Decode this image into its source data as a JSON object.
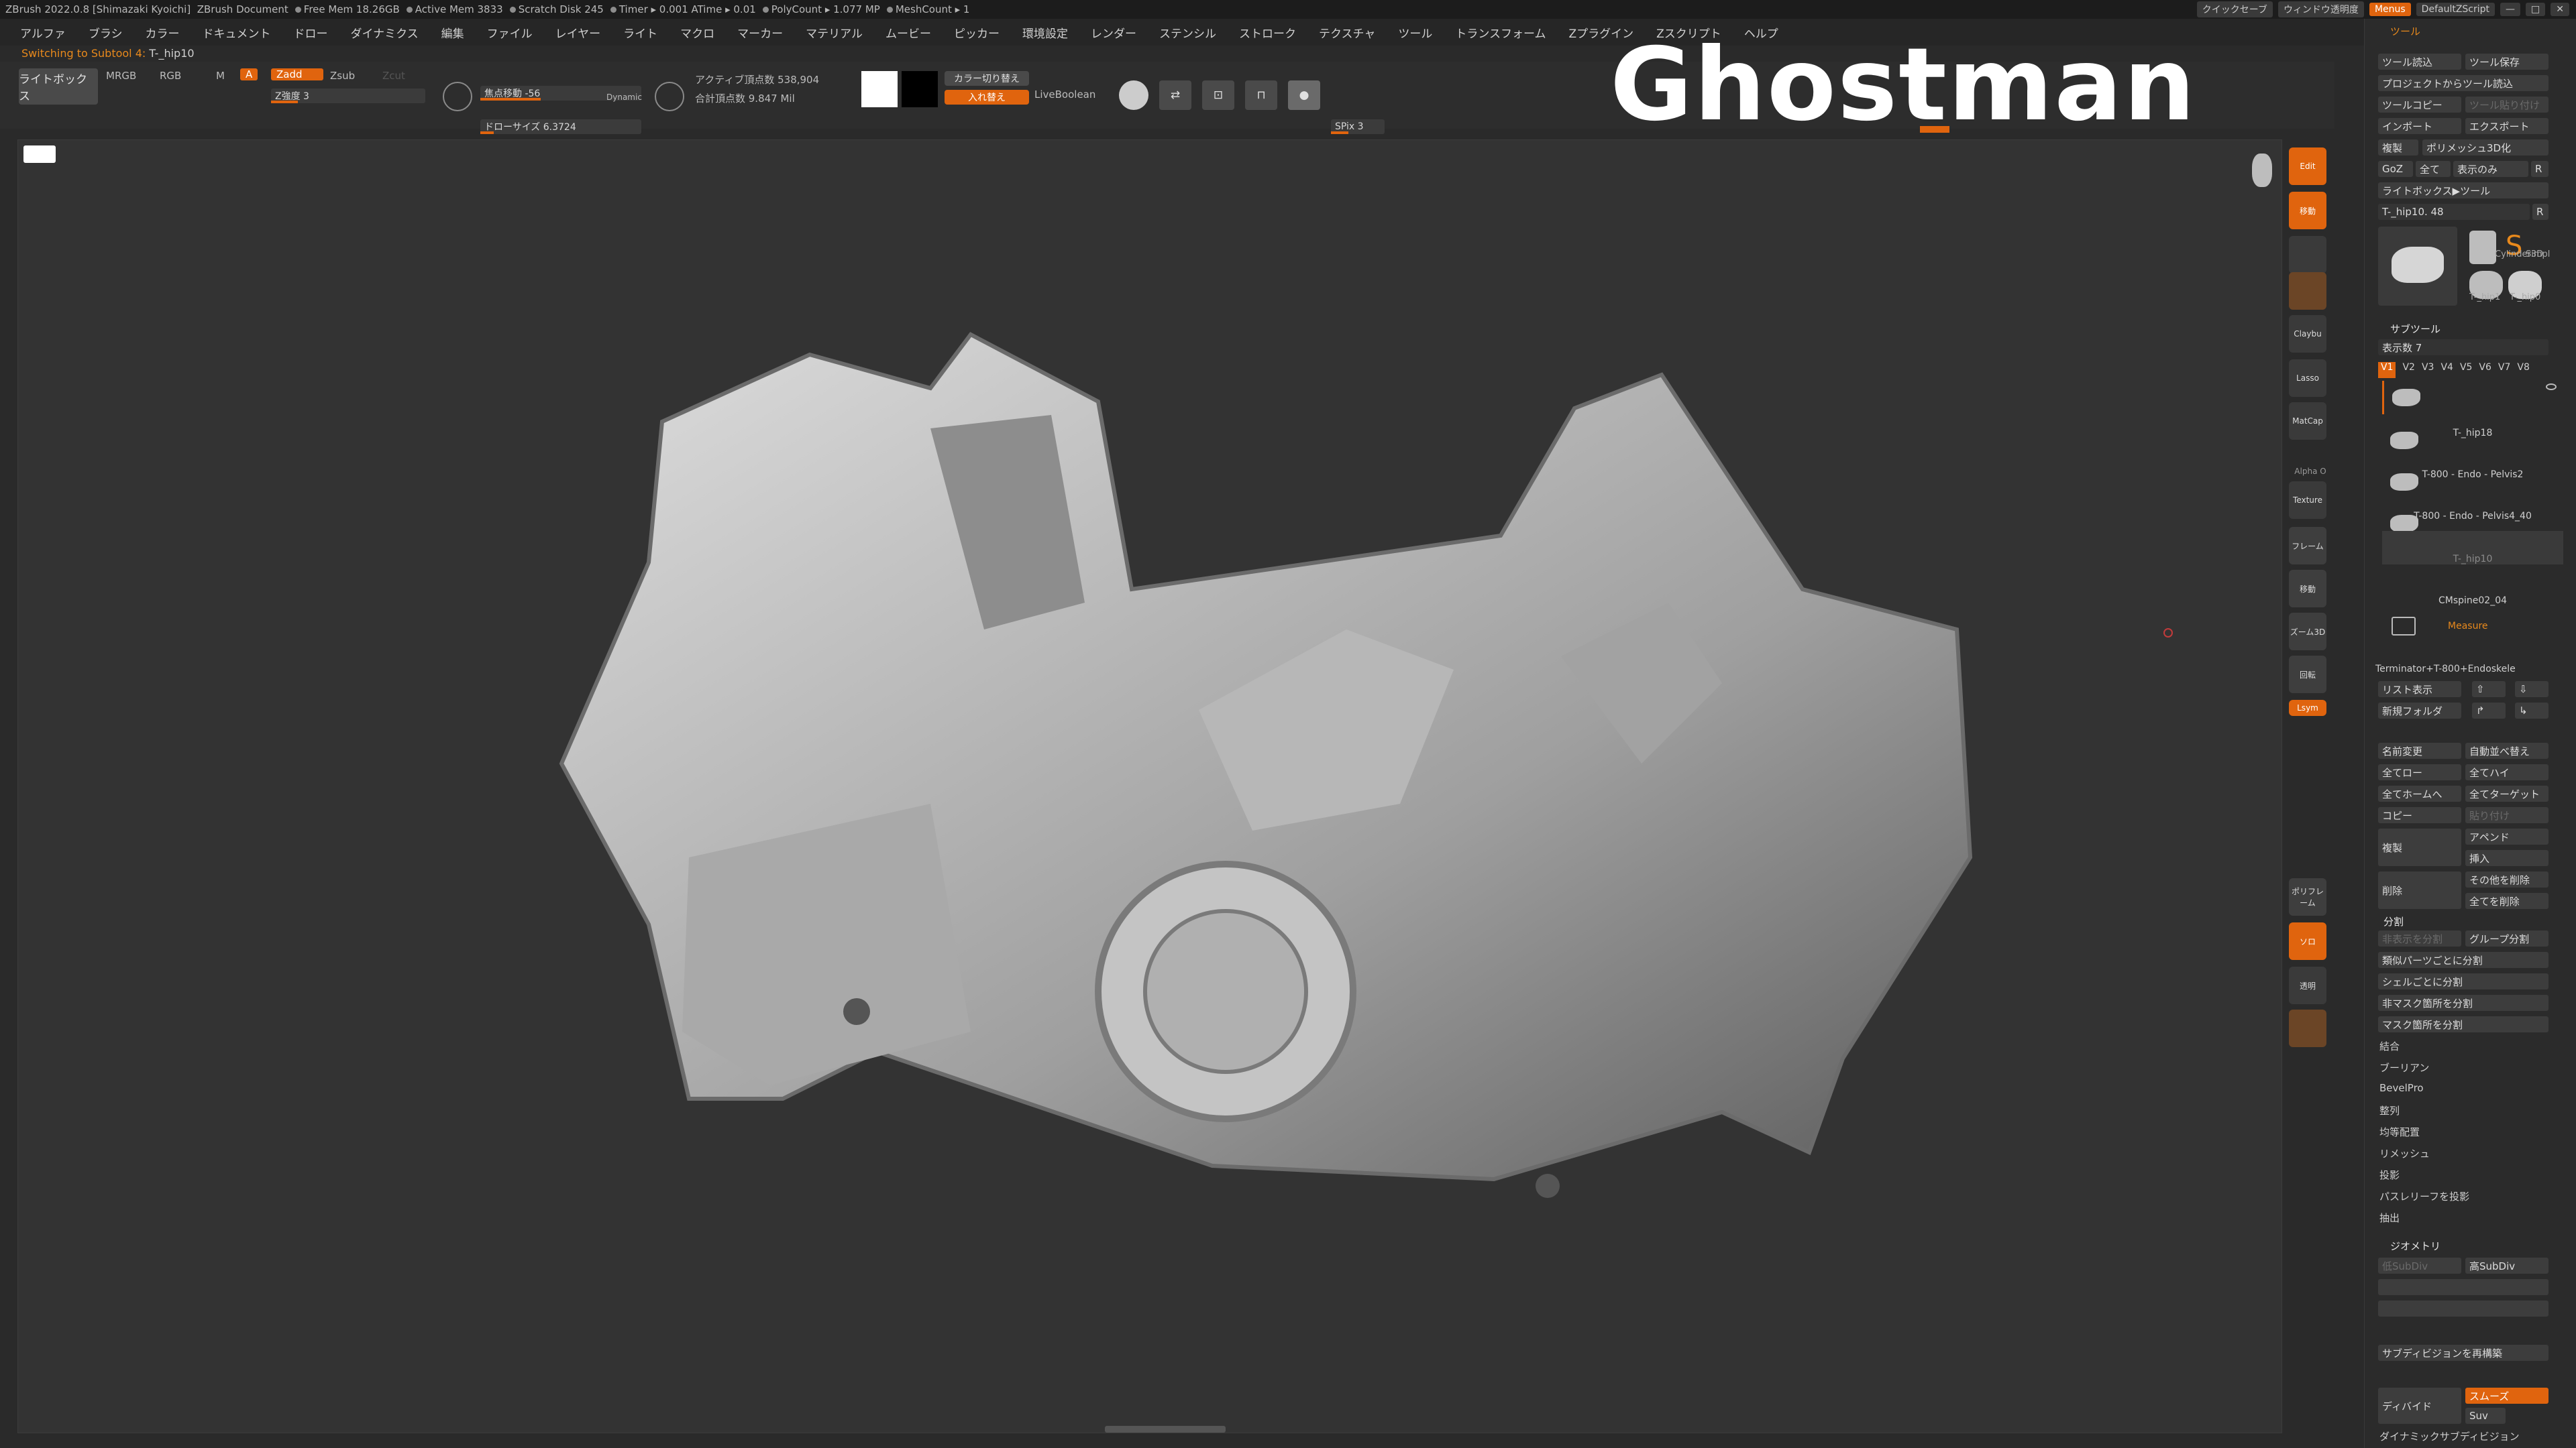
{
  "titlebar": {
    "app": "ZBrush 2022.0.8 [Shimazaki Kyoichi]",
    "doc": "ZBrush Document",
    "free_mem": "Free Mem 18.26GB",
    "active_mem": "Active Mem 3833",
    "scratch": "Scratch Disk 245",
    "timer": "Timer ▸ 0.001 ATime ▸ 0.01",
    "polycount": "PolyCount ▸ 1.077 MP",
    "meshcount": "MeshCount ▸ 1",
    "quicksave": "クイックセーブ",
    "window_transparency": "ウィンドウ透明度",
    "menus": "Menus",
    "script": "DefaultZScript"
  },
  "menubar": [
    "アルファ",
    "ブラシ",
    "カラー",
    "ドキュメント",
    "ドロー",
    "ダイナミクス",
    "編集",
    "ファイル",
    "レイヤー",
    "ライト",
    "マクロ",
    "マーカー",
    "マテリアル",
    "ムービー",
    "ピッカー",
    "環境設定",
    "レンダー",
    "ステンシル",
    "ストローク",
    "テクスチャ",
    "ツール",
    "トランスフォーム",
    "Zプラグイン",
    "Zスクリプト",
    "ヘルプ"
  ],
  "status": {
    "prefix": "Switching to Subtool 4:",
    "name": "T-_hip10"
  },
  "toolbar": {
    "lightbox": "ライトボックス",
    "mrgb": "MRGB",
    "rgb": "RGB",
    "m": "M",
    "a": "A",
    "zadd": "Zadd",
    "zsub": "Zsub",
    "zcut": "Zcut",
    "zintensity": "Z強度 3",
    "focal": "焦点移動 -56",
    "draw_size": "ドローサイズ 6.3724",
    "dynamic": "Dynamic",
    "active_points": "アクティブ頂点数 538,904",
    "total_points": "合計頂点数 9.847 Mil",
    "color_switch": "カラー切り替え",
    "swap": "入れ替え",
    "liveboolean": "LiveBoolean",
    "spix": "SPix 3"
  },
  "viewport": {
    "watermark": "Ghostman",
    "accent": "#e0640e"
  },
  "right_shelf": [
    {
      "label": "Edit",
      "icon": "edit-icon"
    },
    {
      "label": "移動",
      "icon": "move-icon"
    },
    {
      "label": "",
      "icon": "scale-icon"
    },
    {
      "label": "Claybu",
      "icon": "claybuildup-icon"
    },
    {
      "label": "Lasso",
      "icon": "lasso-icon"
    },
    {
      "label": "MatCap",
      "icon": "matcap-icon"
    },
    {
      "label": "Alpha O",
      "icon": "alpha-icon"
    },
    {
      "label": "Texture",
      "icon": "texture-icon"
    },
    {
      "label": "フレーム",
      "icon": "frame-icon"
    },
    {
      "label": "移動",
      "icon": "move-view-icon"
    },
    {
      "label": "ズーム3D",
      "icon": "zoom-icon"
    },
    {
      "label": "回転",
      "icon": "rotate-icon"
    },
    {
      "label": "Lsym",
      "icon": "lsym-icon"
    },
    {
      "label": "ポリフレーム",
      "icon": "polyframe-icon"
    },
    {
      "label": "ソロ",
      "icon": "solo-icon"
    },
    {
      "label": "透明",
      "icon": "transparency-icon"
    }
  ],
  "tool_panel": {
    "title": "ツール",
    "load": "ツール読込",
    "save": "ツール保存",
    "load_from_project": "プロジェクトからツール読込",
    "copy": "ツールコピー",
    "paste": "ツール貼り付け",
    "import": "インポート",
    "export": "エクスポート",
    "clone": "複製",
    "make_polymesh": "ポリメッシュ3D化",
    "goz": "GoZ",
    "all": "全て",
    "visible": "表示のみ",
    "r": "R",
    "lightbox_tools": "ライトボックス▶ツール",
    "current_tool": "T-_hip10. 48",
    "thumbs": [
      "T-_hip10",
      "Cylinder3D",
      "SimpleB",
      "T-_hip1",
      "T-_hip0"
    ]
  },
  "subtool": {
    "title": "サブツール",
    "visible_count": "表示数 7",
    "versions": [
      "V1",
      "V2",
      "V3",
      "V4",
      "V5",
      "V6",
      "V7",
      "V8"
    ],
    "items": [
      "",
      "T-_hip18",
      "T-800 - Endo - Pelvis2",
      "T-800 - Endo - Pelvis4_40",
      "T-_hip10",
      "CMspine02_04",
      "Measure",
      "Terminator+T-800+Endoskele"
    ],
    "list_all": "リスト表示",
    "new_folder": "新規フォルダ",
    "rename": "名前変更",
    "auto_reorder": "自動並べ替え",
    "all_low": "全てロー",
    "all_high": "全てハイ",
    "all_home": "全てホームへ",
    "all_target": "全てターゲット",
    "copy": "コピー",
    "paste": "貼り付け",
    "duplicate": "複製",
    "append": "アペンド",
    "insert": "挿入",
    "delete": "削除",
    "del_other": "その他を削除",
    "del_all": "全てを削除"
  },
  "split": {
    "title": "分割",
    "split_hidden": "非表示を分割",
    "groups_split": "グループ分割",
    "split_similar": "類似パーツごとに分割",
    "split_shells": "シェルごとに分割",
    "split_unmasked": "非マスク箇所を分割",
    "split_masked": "マスク箇所を分割"
  },
  "menu_items": [
    "結合",
    "ブーリアン",
    "BevelPro",
    "整列",
    "均等配置",
    "リメッシュ",
    "投影",
    "パスレリーフを投影",
    "抽出"
  ],
  "geometry": {
    "title": "ジオメトリ",
    "lower_res": "低SubDiv",
    "higher_res": "高SubDiv",
    "rebuild": "サブディビジョンを再構築",
    "divide": "ディバイド",
    "smooth": "スムーズ",
    "suv": "Suv",
    "dynamic_subdiv": "ダイナミックサブディビジョン"
  }
}
